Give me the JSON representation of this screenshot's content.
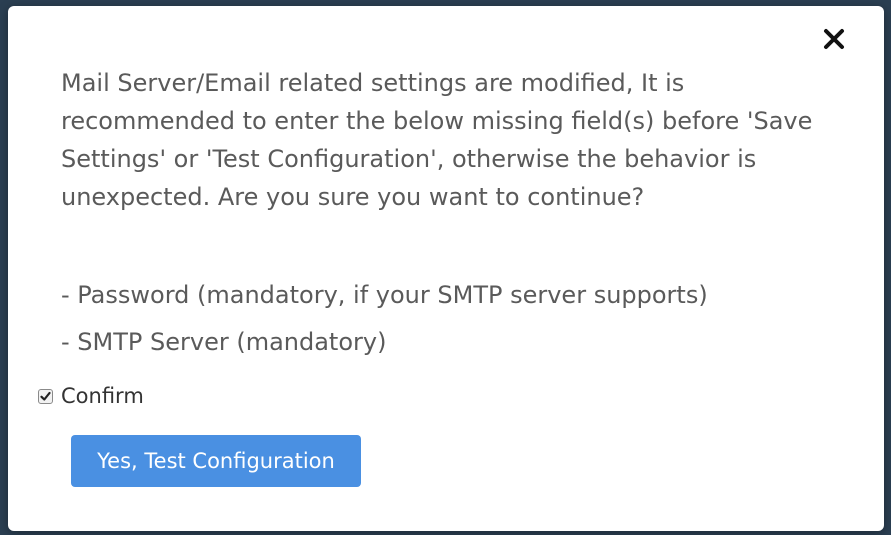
{
  "dialog": {
    "message": "Mail Server/Email related settings are modified, It is recommended to enter the below missing field(s) before 'Save Settings' or 'Test Configuration', otherwise the behavior is unexpected. Are you sure you want to continue?",
    "missing_fields": [
      "- Password (mandatory, if your SMTP server supports)",
      "- SMTP Server (mandatory)"
    ],
    "confirm": {
      "label": "Confirm",
      "checked": true
    },
    "primary_button_label": "Yes, Test Configuration",
    "close_icon": "close-icon"
  },
  "colors": {
    "primary": "#4a90e2",
    "text": "#5a5a5a",
    "backdrop": "#2b3f52"
  }
}
